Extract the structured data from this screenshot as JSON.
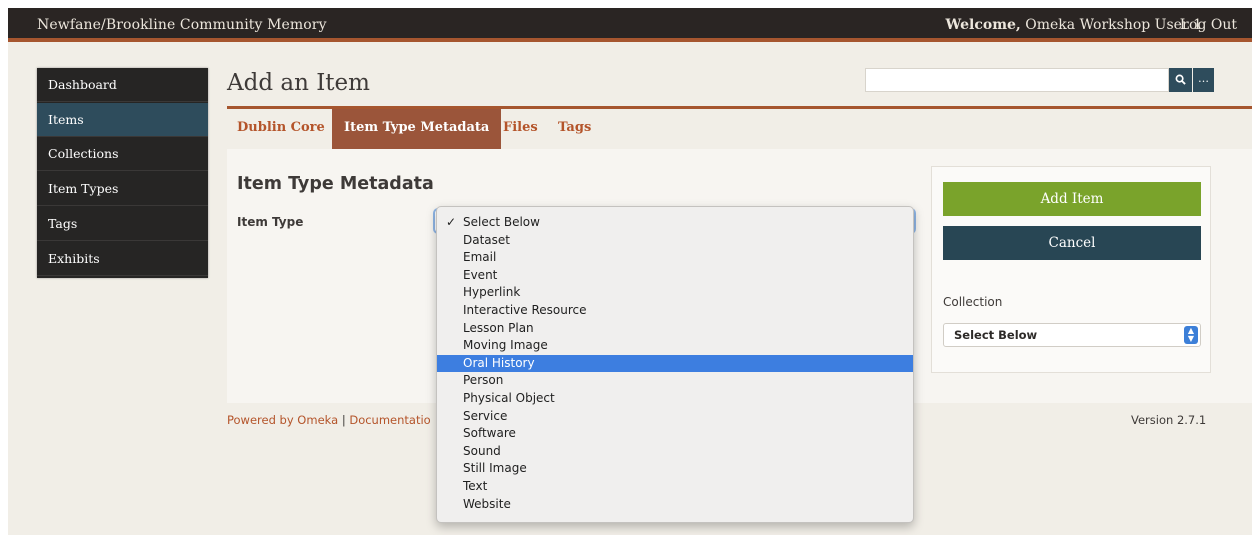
{
  "header": {
    "site_title": "Newfane/Brookline Community Memory",
    "welcome_label": "Welcome,",
    "user_name": "Omeka Workshop User 1",
    "logout": "Log Out"
  },
  "sidebar": {
    "items": [
      {
        "label": "Dashboard"
      },
      {
        "label": "Items"
      },
      {
        "label": "Collections"
      },
      {
        "label": "Item Types"
      },
      {
        "label": "Tags"
      },
      {
        "label": "Exhibits"
      }
    ],
    "active": "Items"
  },
  "page": {
    "title": "Add an Item",
    "search": {
      "value": "",
      "placeholder": ""
    }
  },
  "tabs": [
    {
      "label": "Dublin Core"
    },
    {
      "label": "Item Type Metadata"
    },
    {
      "label": "Files"
    },
    {
      "label": "Tags"
    }
  ],
  "main": {
    "section_heading": "Item Type Metadata",
    "item_type_label": "Item Type",
    "item_type_dropdown": {
      "selected": "Select Below",
      "highlighted": "Oral History",
      "options": [
        "Select Below",
        "Dataset",
        "Email",
        "Event",
        "Hyperlink",
        "Interactive Resource",
        "Lesson Plan",
        "Moving Image",
        "Oral History",
        "Person",
        "Physical Object",
        "Service",
        "Software",
        "Sound",
        "Still Image",
        "Text",
        "Website"
      ]
    }
  },
  "actions": {
    "add_item": "Add Item",
    "cancel": "Cancel",
    "collection_label": "Collection",
    "collection_selected": "Select Below"
  },
  "footer": {
    "powered_by": "Powered by Omeka",
    "separator": "|",
    "documentation": "Documentatio",
    "version": "Version 2.7.1"
  },
  "colors": {
    "accent": "#a6562f",
    "nav_active": "#2e4c5c",
    "add_button": "#7aa32b",
    "cancel_button": "#284654",
    "highlight": "#3d7ee0"
  }
}
